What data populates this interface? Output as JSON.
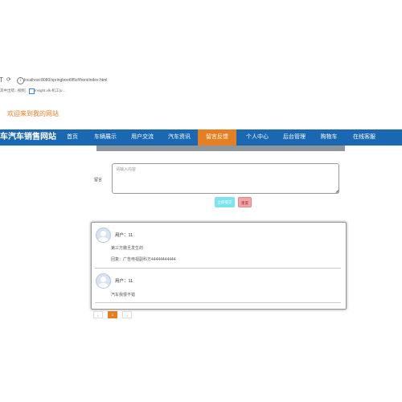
{
  "browser": {
    "back_glyph": "T",
    "refresh_glyph": "⟳",
    "info_glyph": "i",
    "url": "localhost:8080/springboot9f5cf/front/index.html",
    "bookmarks": [
      {
        "label": "其中出错 : 视频..."
      },
      {
        "label": "Insight.vlk-机工(u..."
      }
    ]
  },
  "header": {
    "welcome": "欢迎来到我的网站",
    "site_title": "车汽车销售网站"
  },
  "nav": {
    "items": [
      {
        "label": "首页"
      },
      {
        "label": "车辆展示"
      },
      {
        "label": "用户交流"
      },
      {
        "label": "汽车资讯"
      },
      {
        "label": "留言反馈"
      },
      {
        "label": "个人中心"
      },
      {
        "label": "后台管理"
      },
      {
        "label": "购物车"
      },
      {
        "label": "在线客服"
      }
    ],
    "active_index": 4
  },
  "form": {
    "label": "留言",
    "placeholder": "请输入内容",
    "resize_glyph": "◢",
    "submit_label": "立即提交",
    "reset_label": "重置"
  },
  "messages": [
    {
      "user": "用户：11",
      "content": "第三方撒旦发生的",
      "reply": "回复：广告电视副科方44444444444"
    },
    {
      "user": "用户：11",
      "content": "汽车我很不错"
    }
  ],
  "pagination": {
    "prev": "<",
    "current": "1",
    "next": ">"
  },
  "colors": {
    "nav_bg": "#1a67b2",
    "accent": "#e67e22",
    "submit": "#7de3ef",
    "reset": "#f4a4a4"
  }
}
